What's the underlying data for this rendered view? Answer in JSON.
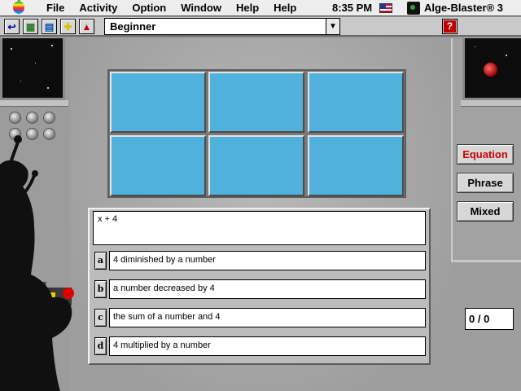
{
  "menubar": {
    "items": [
      "File",
      "Activity",
      "Option",
      "Window",
      "Help",
      "Help"
    ],
    "clock": "8:35 PM",
    "app_name": "Alge-Blaster® 3"
  },
  "toolbar": {
    "level": "Beginner",
    "buttons": [
      {
        "name": "back-arrow-icon"
      },
      {
        "name": "calculator-icon"
      },
      {
        "name": "grid-icon"
      },
      {
        "name": "plus-icon"
      },
      {
        "name": "ship-icon"
      }
    ],
    "help_label": "?",
    "dropdown_arrow": "▼"
  },
  "modes": {
    "equation": "Equation",
    "phrase": "Phrase",
    "mixed": "Mixed",
    "active": "Equation",
    "active_color": "#d00000"
  },
  "score": "0 / 0",
  "question": {
    "expression": "x + 4",
    "choices": [
      {
        "key": "a",
        "text": "4 diminished by a number"
      },
      {
        "key": "b",
        "text": "a number decreased by 4"
      },
      {
        "key": "c",
        "text": "the sum of a number and 4"
      },
      {
        "key": "d",
        "text": "4 multiplied by a number"
      }
    ]
  },
  "tiles": {
    "count": 6,
    "color": "#4fb1dc"
  }
}
